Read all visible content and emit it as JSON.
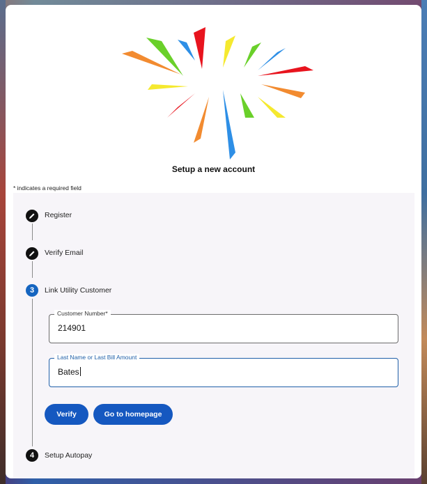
{
  "page": {
    "title": "Setup a new account",
    "required_note": "* indicates a required field"
  },
  "logo": {
    "name": "burst-logo"
  },
  "steps": [
    {
      "number": "",
      "label": "Register",
      "state": "completed",
      "icon": "pencil-icon"
    },
    {
      "number": "",
      "label": "Verify Email",
      "state": "completed",
      "icon": "pencil-icon"
    },
    {
      "number": "3",
      "label": "Link Utility Customer",
      "state": "active"
    },
    {
      "number": "4",
      "label": "Setup Autopay",
      "state": "pending"
    }
  ],
  "form": {
    "customer_number": {
      "label": "Customer Number*",
      "value": "214901"
    },
    "last_name": {
      "label": "Last Name or Last Bill Amount",
      "value": "Bates"
    }
  },
  "buttons": {
    "verify": "Verify",
    "homepage": "Go to homepage"
  },
  "colors": {
    "accent": "#1558c0",
    "active_step": "#1565c0",
    "panel_bg": "#f7f5f9"
  }
}
